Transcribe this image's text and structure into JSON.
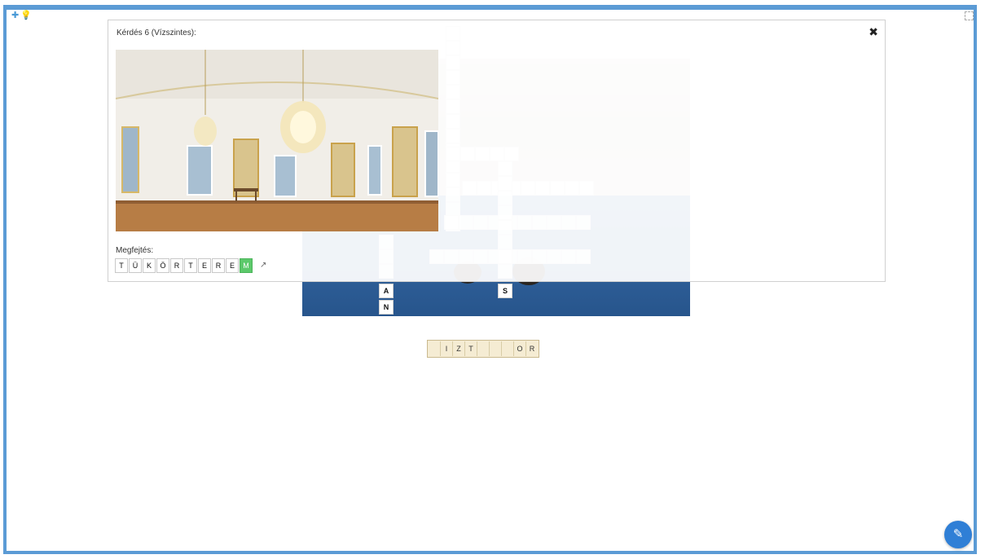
{
  "dialog": {
    "title": "Kérdés 6 (Vízszintes):",
    "close_icon": "close-icon",
    "solution_label": "Megfejtés:",
    "solution_letters": [
      "T",
      "Ü",
      "K",
      "Ö",
      "R",
      "T",
      "E",
      "R",
      "E",
      "M"
    ],
    "highlighted_index": 9,
    "expand_icon": "external-link-icon"
  },
  "board": {
    "visible_letters": [
      "A",
      "N",
      "S"
    ]
  },
  "answer_strip": {
    "letters": [
      "",
      "I",
      "Z",
      "T",
      "",
      "",
      "",
      "O",
      "R"
    ]
  },
  "toolbar": {
    "left_icons": [
      "puzzle-icon",
      "lightbulb-icon"
    ],
    "fullscreen_icon": "fullscreen-icon"
  },
  "fab": {
    "icon": "edit-icon"
  },
  "colors": {
    "frame_border": "#5b9bd5",
    "highlight": "#5cc96b",
    "fab": "#2f7fd6"
  }
}
